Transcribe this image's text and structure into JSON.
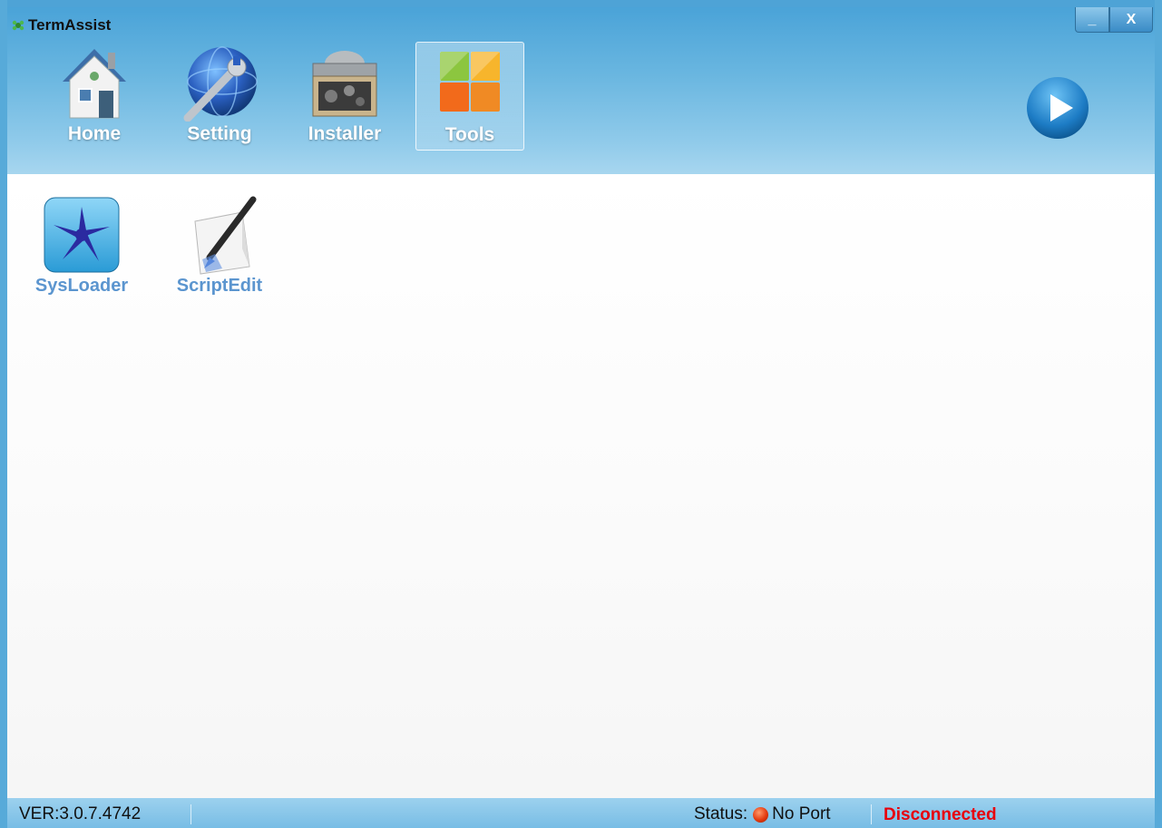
{
  "window": {
    "title": "TermAssist",
    "minimize_label": "_",
    "close_label": "X"
  },
  "nav": {
    "items": [
      {
        "label": "Home",
        "icon": "house-icon",
        "active": false
      },
      {
        "label": "Setting",
        "icon": "globe-wrench-icon",
        "active": false
      },
      {
        "label": "Installer",
        "icon": "installer-box-icon",
        "active": false
      },
      {
        "label": "Tools",
        "icon": "tiles-icon",
        "active": true
      }
    ]
  },
  "tools": [
    {
      "label": "SysLoader",
      "icon": "starfish-icon"
    },
    {
      "label": "ScriptEdit",
      "icon": "pen-paper-icon"
    }
  ],
  "statusbar": {
    "version": "VER:3.0.7.4742",
    "status_label": "Status:",
    "port": "No Port",
    "connection": "Disconnected"
  },
  "colors": {
    "accent": "#4ea3d6",
    "tool_label": "#5b95cf",
    "disconnected": "#e8000b"
  }
}
